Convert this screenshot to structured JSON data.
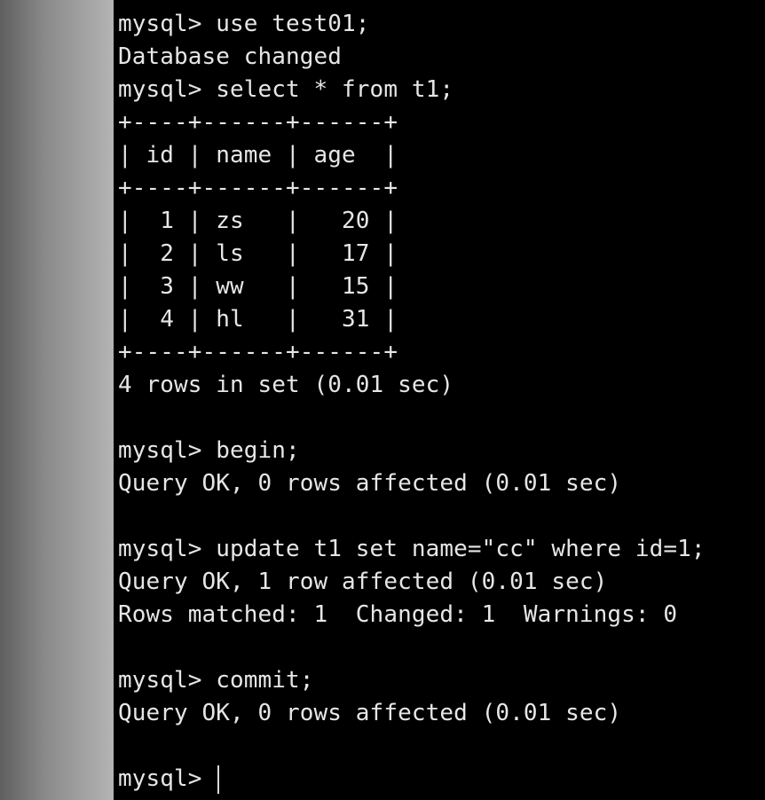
{
  "terminal": {
    "lines": [
      "mysql> use test01;",
      "Database changed",
      "mysql> select * from t1;",
      "+----+------+------+",
      "| id | name | age  |",
      "+----+------+------+",
      "|  1 | zs   |   20 |",
      "|  2 | ls   |   17 |",
      "|  3 | ww   |   15 |",
      "|  4 | hl   |   31 |",
      "+----+------+------+",
      "4 rows in set (0.01 sec)",
      "",
      "mysql> begin;",
      "Query OK, 0 rows affected (0.01 sec)",
      "",
      "mysql> update t1 set name=\"cc\" where id=1;",
      "Query OK, 1 row affected (0.01 sec)",
      "Rows matched: 1  Changed: 1  Warnings: 0",
      "",
      "mysql> commit;",
      "Query OK, 0 rows affected (0.01 sec)",
      ""
    ],
    "prompt": "mysql> "
  },
  "colors": {
    "background": "#000000",
    "text": "#e6e6e6",
    "gutter": "#8a8a8a"
  }
}
